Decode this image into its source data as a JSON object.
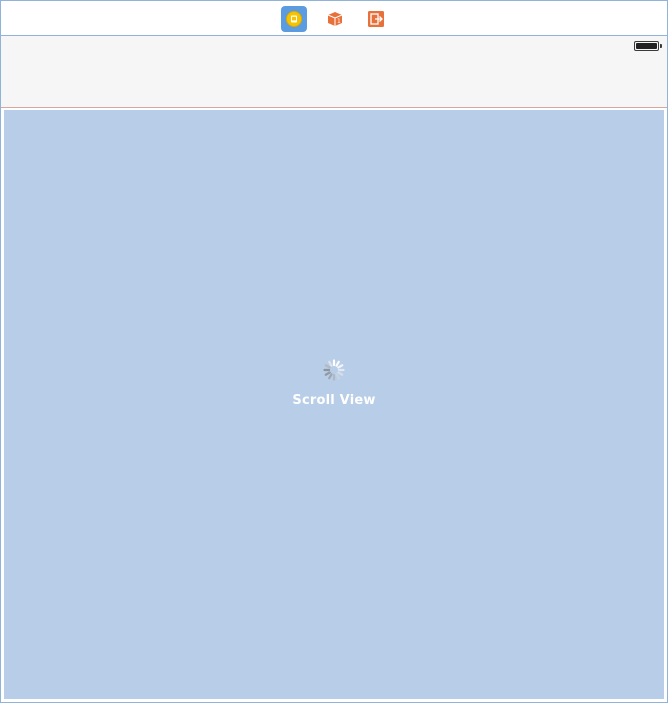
{
  "scene_dock": {
    "items": [
      {
        "icon": "view-controller-icon",
        "color": "#f5c400",
        "selected": true
      },
      {
        "icon": "first-responder-icon",
        "color": "#e8703a",
        "selected": false
      },
      {
        "icon": "exit-icon",
        "color": "#e8703a",
        "selected": false
      }
    ]
  },
  "status_bar": {
    "battery_icon": "battery-icon",
    "battery_level": 1.0
  },
  "scroll_view": {
    "label": "Scroll View",
    "background": "#b8cde7",
    "icon": "activity-spinner-icon"
  }
}
